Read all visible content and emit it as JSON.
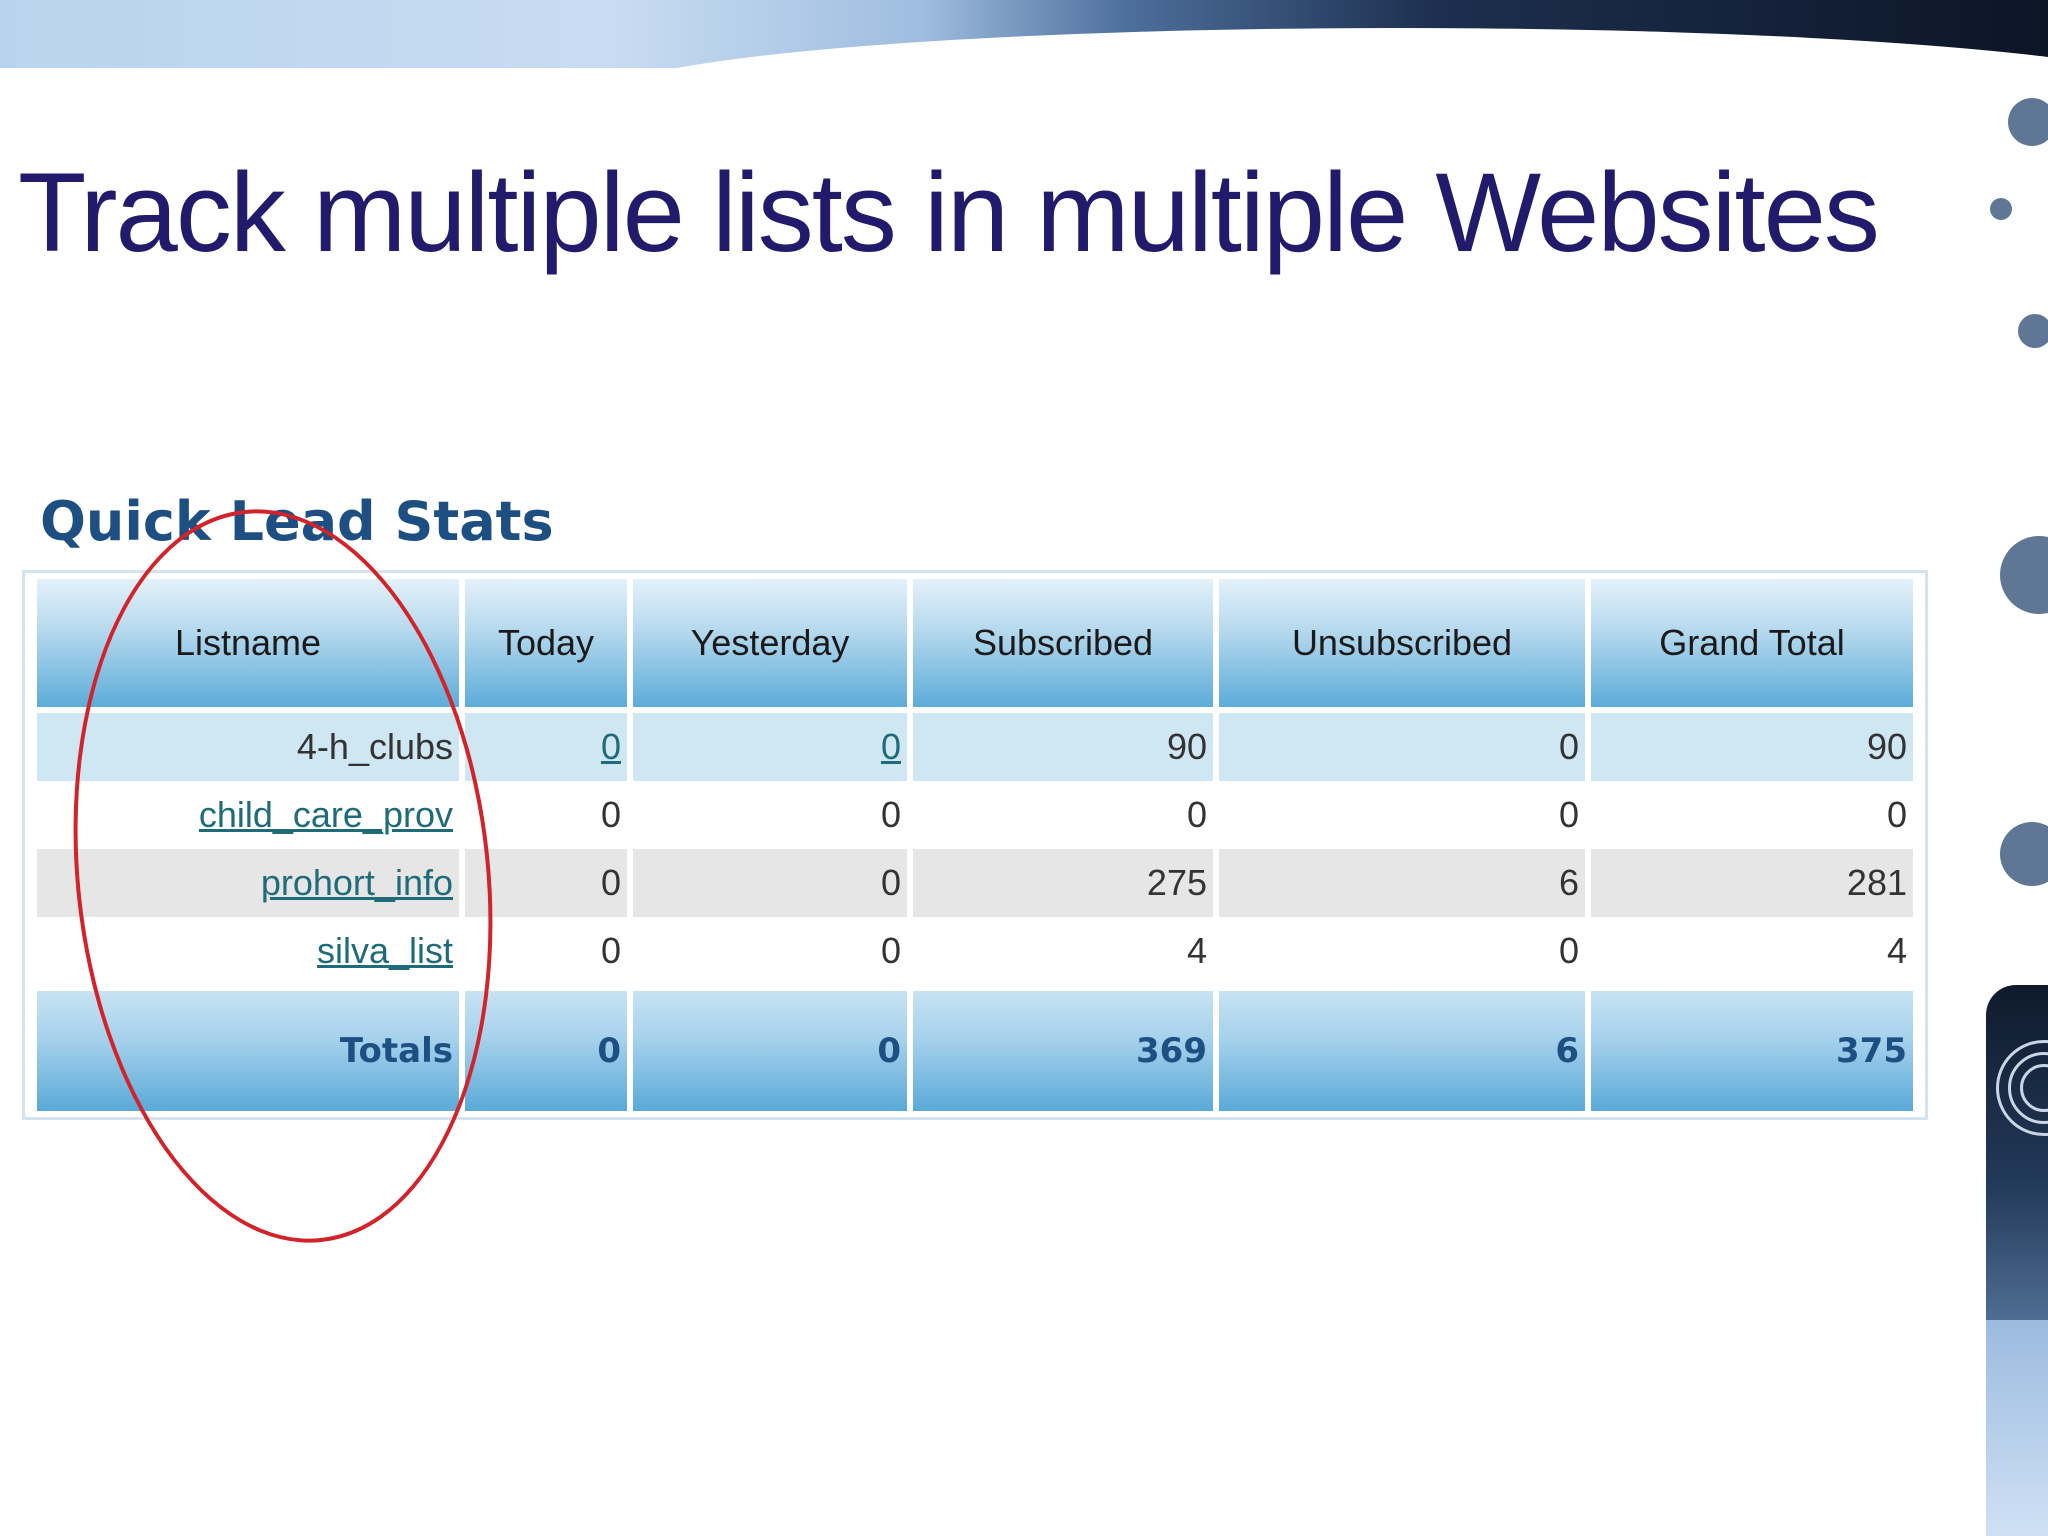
{
  "slide": {
    "title": "Track multiple lists in multiple Websites"
  },
  "panel": {
    "heading": "Quick Lead Stats"
  },
  "table": {
    "columns": [
      "Listname",
      "Today",
      "Yesterday",
      "Subscribed",
      "Unsubscribed",
      "Grand Total"
    ],
    "rows": [
      {
        "listname": "4-h_clubs",
        "listname_link": false,
        "today": "0",
        "today_link": true,
        "yesterday": "0",
        "yesterday_link": true,
        "subscribed": "90",
        "unsubscribed": "0",
        "grand_total": "90"
      },
      {
        "listname": "child_care_prov",
        "listname_link": true,
        "today": "0",
        "yesterday": "0",
        "subscribed": "0",
        "unsubscribed": "0",
        "grand_total": "0"
      },
      {
        "listname": "prohort_info",
        "listname_link": true,
        "today": "0",
        "yesterday": "0",
        "subscribed": "275",
        "unsubscribed": "6",
        "grand_total": "281"
      },
      {
        "listname": "silva_list",
        "listname_link": true,
        "today": "0",
        "yesterday": "0",
        "subscribed": "4",
        "unsubscribed": "0",
        "grand_total": "4"
      }
    ],
    "totals": {
      "label": "Totals",
      "today": "0",
      "yesterday": "0",
      "subscribed": "369",
      "unsubscribed": "6",
      "grand_total": "375"
    }
  },
  "colors": {
    "title": "#221a6b",
    "heading": "#1e4f82",
    "annotation": "#d2232a",
    "link": "#1f6b7a"
  },
  "annotation": {
    "shape": "ellipse",
    "target": "listname-column"
  }
}
